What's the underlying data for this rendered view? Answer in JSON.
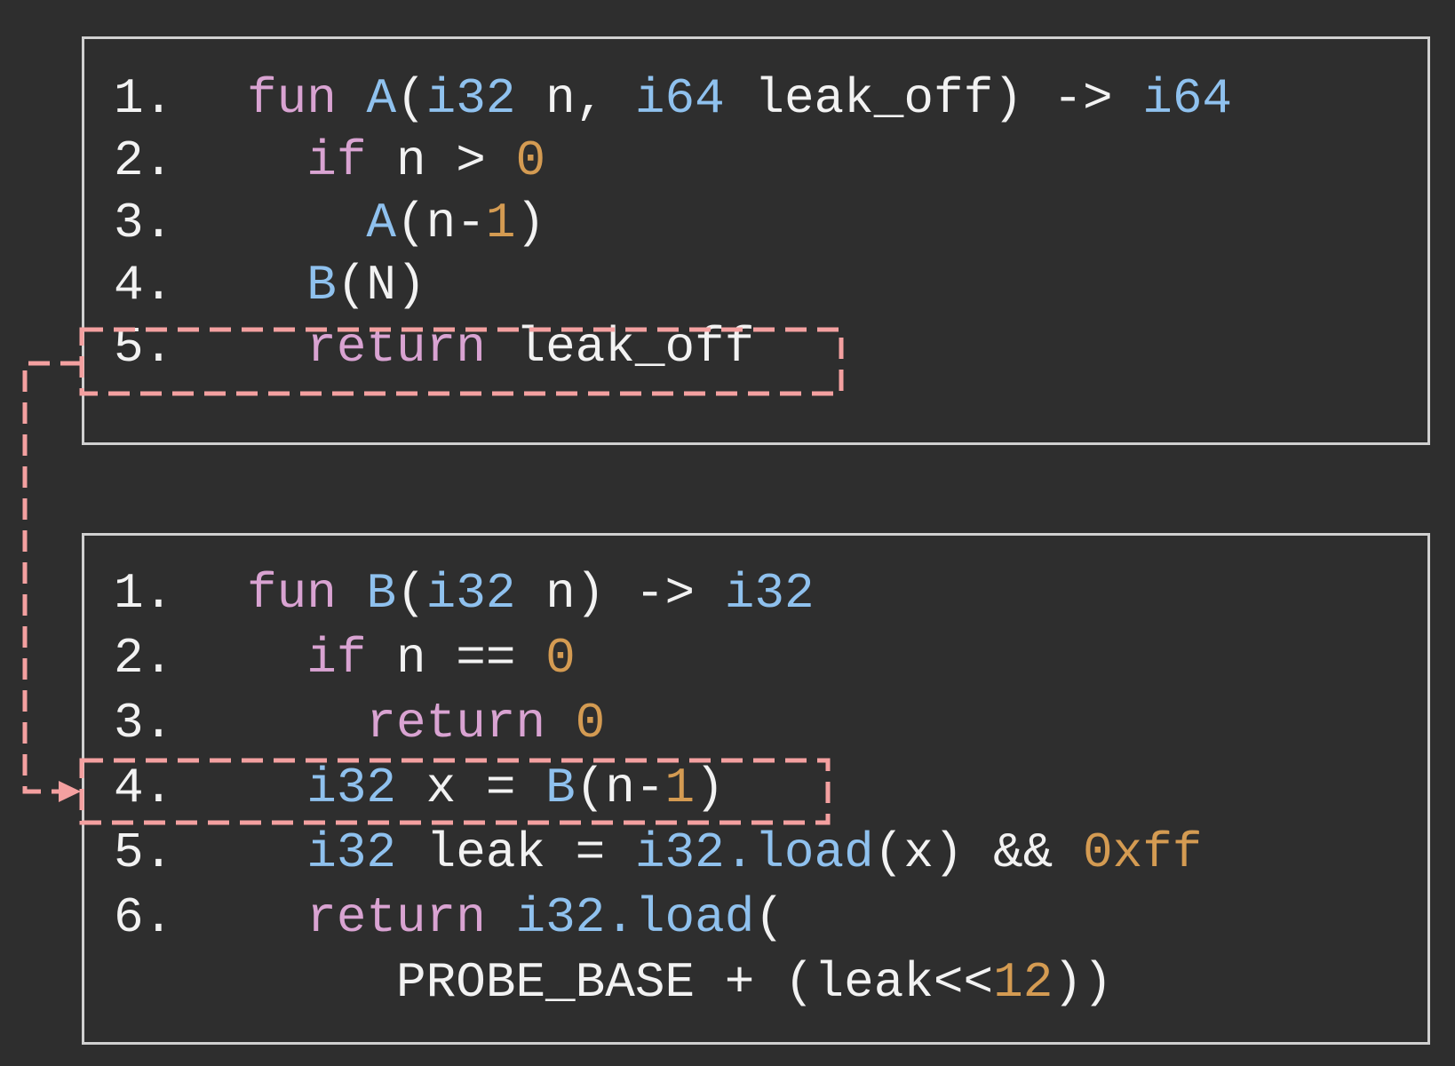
{
  "colors": {
    "background": "#2e2e2e",
    "box_border": "#d0d0d0",
    "plain": "#f2f2f2",
    "keyword": "#d9a3d2",
    "type": "#8fc1ee",
    "number": "#d49b52",
    "highlight": "#f4a0a0"
  },
  "function_a": {
    "lines": [
      {
        "num": "1.",
        "tokens": [
          {
            "t": "fun",
            "c": "kw"
          },
          {
            "t": " ",
            "c": "tx"
          },
          {
            "t": "A",
            "c": "fn"
          },
          {
            "t": "(",
            "c": "tx"
          },
          {
            "t": "i32",
            "c": "ty"
          },
          {
            "t": " n, ",
            "c": "tx"
          },
          {
            "t": "i64",
            "c": "ty"
          },
          {
            "t": " leak_off) -> ",
            "c": "tx"
          },
          {
            "t": "i64",
            "c": "ty"
          }
        ]
      },
      {
        "num": "2.",
        "tokens": [
          {
            "t": "  ",
            "c": "tx"
          },
          {
            "t": "if",
            "c": "kw"
          },
          {
            "t": " n > ",
            "c": "tx"
          },
          {
            "t": "0",
            "c": "nm"
          }
        ]
      },
      {
        "num": "3.",
        "tokens": [
          {
            "t": "    ",
            "c": "tx"
          },
          {
            "t": "A",
            "c": "fn"
          },
          {
            "t": "(n-",
            "c": "tx"
          },
          {
            "t": "1",
            "c": "nm"
          },
          {
            "t": ")",
            "c": "tx"
          }
        ]
      },
      {
        "num": "4.",
        "tokens": [
          {
            "t": "  ",
            "c": "tx"
          },
          {
            "t": "B",
            "c": "fn"
          },
          {
            "t": "(N)",
            "c": "tx"
          }
        ]
      },
      {
        "num": "5.",
        "tokens": [
          {
            "t": "  ",
            "c": "tx"
          },
          {
            "t": "return",
            "c": "kw"
          },
          {
            "t": " leak_off",
            "c": "tx"
          }
        ]
      }
    ]
  },
  "function_b": {
    "lines": [
      {
        "num": "1.",
        "tokens": [
          {
            "t": "fun",
            "c": "kw"
          },
          {
            "t": " ",
            "c": "tx"
          },
          {
            "t": "B",
            "c": "fn"
          },
          {
            "t": "(",
            "c": "tx"
          },
          {
            "t": "i32",
            "c": "ty"
          },
          {
            "t": " n) -> ",
            "c": "tx"
          },
          {
            "t": "i32",
            "c": "ty"
          }
        ]
      },
      {
        "num": "2.",
        "tokens": [
          {
            "t": "  ",
            "c": "tx"
          },
          {
            "t": "if",
            "c": "kw"
          },
          {
            "t": " n == ",
            "c": "tx"
          },
          {
            "t": "0",
            "c": "nm"
          }
        ]
      },
      {
        "num": "3.",
        "tokens": [
          {
            "t": "    ",
            "c": "tx"
          },
          {
            "t": "return",
            "c": "kw"
          },
          {
            "t": " ",
            "c": "tx"
          },
          {
            "t": "0",
            "c": "nm"
          }
        ]
      },
      {
        "num": "4.",
        "tokens": [
          {
            "t": "  ",
            "c": "tx"
          },
          {
            "t": "i32",
            "c": "ty"
          },
          {
            "t": " x = ",
            "c": "tx"
          },
          {
            "t": "B",
            "c": "fn"
          },
          {
            "t": "(n-",
            "c": "tx"
          },
          {
            "t": "1",
            "c": "nm"
          },
          {
            "t": ")",
            "c": "tx"
          }
        ]
      },
      {
        "num": "5.",
        "tokens": [
          {
            "t": "  ",
            "c": "tx"
          },
          {
            "t": "i32",
            "c": "ty"
          },
          {
            "t": " leak = ",
            "c": "tx"
          },
          {
            "t": "i32.load",
            "c": "ty"
          },
          {
            "t": "(x) && ",
            "c": "tx"
          },
          {
            "t": "0xff",
            "c": "nm"
          }
        ]
      },
      {
        "num": "6.",
        "tokens": [
          {
            "t": "  ",
            "c": "tx"
          },
          {
            "t": "return",
            "c": "kw"
          },
          {
            "t": " ",
            "c": "tx"
          },
          {
            "t": "i32.load",
            "c": "ty"
          },
          {
            "t": "(",
            "c": "tx"
          }
        ]
      },
      {
        "num": "",
        "tokens": [
          {
            "t": "     PROBE_BASE + (leak<<",
            "c": "tx"
          },
          {
            "t": "12",
            "c": "nm"
          },
          {
            "t": "))",
            "c": "tx"
          }
        ]
      }
    ]
  }
}
